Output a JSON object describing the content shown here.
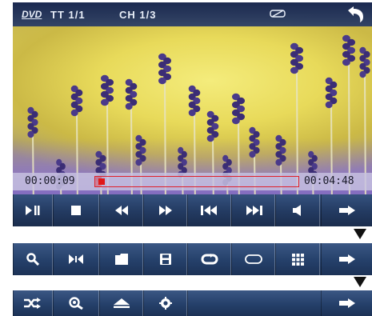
{
  "status_bar": {
    "source": "DVD",
    "title": "TT 1/1",
    "chapter": "CH 1/3",
    "subtitle_icon": "subtitle-off-icon",
    "back_icon": "back-arrow-icon"
  },
  "playback": {
    "current_time": "00:00:09",
    "total_time": "00:04:48",
    "progress": 0.03
  },
  "control_bar": {
    "buttons": [
      "play-pause-icon",
      "stop-icon",
      "rewind-icon",
      "fast-forward-icon",
      "previous-track-icon",
      "next-track-icon",
      "volume-icon",
      "next-page-arrow-icon"
    ]
  },
  "menu_row_2": {
    "buttons": [
      "search-icon",
      "angle-icon",
      "folder-icon",
      "save-icon",
      "repeat-icon",
      "ab-loop-icon",
      "grid-menu-icon",
      "next-page-arrow-icon"
    ]
  },
  "menu_row_3": {
    "buttons": [
      "shuffle-icon",
      "zoom-icon",
      "eject-icon",
      "settings-icon",
      "next-page-arrow-icon"
    ]
  },
  "colors": {
    "toolbar": "#25406a",
    "progress_marker": "#e01818",
    "icon": "#ffffff"
  }
}
